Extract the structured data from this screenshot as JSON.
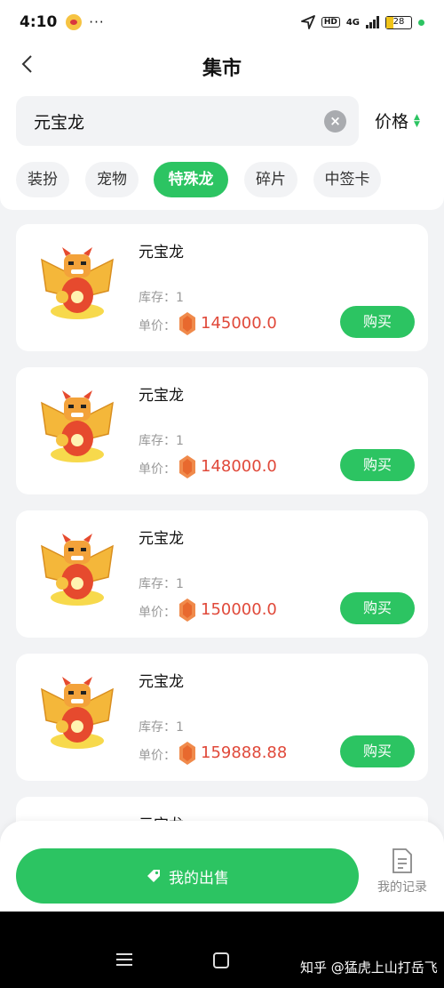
{
  "status_bar": {
    "time": "4:10",
    "dots": "···",
    "network": "4G",
    "battery": "28",
    "hd": "HD"
  },
  "nav": {
    "title": "集市"
  },
  "search": {
    "value": "元宝龙",
    "sort_label": "价格"
  },
  "categories": [
    {
      "label": "装扮",
      "active": false
    },
    {
      "label": "宠物",
      "active": false
    },
    {
      "label": "特殊龙",
      "active": true
    },
    {
      "label": "碎片",
      "active": false
    },
    {
      "label": "中签卡",
      "active": false
    }
  ],
  "listings": [
    {
      "name": "元宝龙",
      "stock": "库存：1",
      "price_label": "单价：",
      "price": "145000.0",
      "buy_label": "购买"
    },
    {
      "name": "元宝龙",
      "stock": "库存：1",
      "price_label": "单价：",
      "price": "148000.0",
      "buy_label": "购买"
    },
    {
      "name": "元宝龙",
      "stock": "库存：1",
      "price_label": "单价：",
      "price": "150000.0",
      "buy_label": "购买"
    },
    {
      "name": "元宝龙",
      "stock": "库存：1",
      "price_label": "单价：",
      "price": "159888.88",
      "buy_label": "购买"
    },
    {
      "name": "元宝龙"
    }
  ],
  "bottom": {
    "sell_label": "我的出售",
    "records_label": "我的记录"
  },
  "watermark": "知乎 @猛虎上山打岳飞",
  "colors": {
    "accent": "#2cc462",
    "price": "#e0493a",
    "background": "#f2f3f5"
  },
  "icons": [
    "back-arrow-icon",
    "clear-icon",
    "sort-icon",
    "gem-icon",
    "tag-icon",
    "document-icon"
  ]
}
